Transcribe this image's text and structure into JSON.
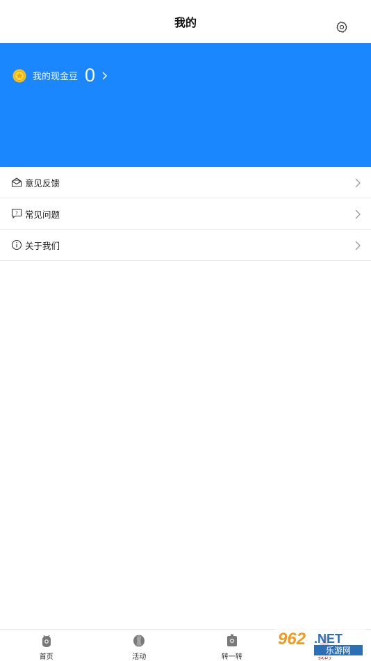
{
  "header": {
    "title": "我的",
    "settings_icon": "gear-icon"
  },
  "banner": {
    "background_color": "#1a86ff",
    "coin_label": "我的现金豆",
    "coin_value": "0",
    "coin_icon": "gold-coin-icon"
  },
  "menu": {
    "items": [
      {
        "label": "意见反馈",
        "icon": "feedback-mail-icon"
      },
      {
        "label": "常见问题",
        "icon": "faq-bubble-icon"
      },
      {
        "label": "关于我们",
        "icon": "info-circle-icon"
      }
    ]
  },
  "tabbar": {
    "tabs": [
      {
        "label": "首页",
        "icon": "home-icon"
      },
      {
        "label": "活动",
        "icon": "activity-icon"
      },
      {
        "label": "转一转",
        "icon": "spin-icon"
      },
      {
        "label": "我的",
        "icon": "profile-icon",
        "active": true
      }
    ]
  },
  "watermark": {
    "brand": "962.NET",
    "subtitle": "乐游网"
  }
}
